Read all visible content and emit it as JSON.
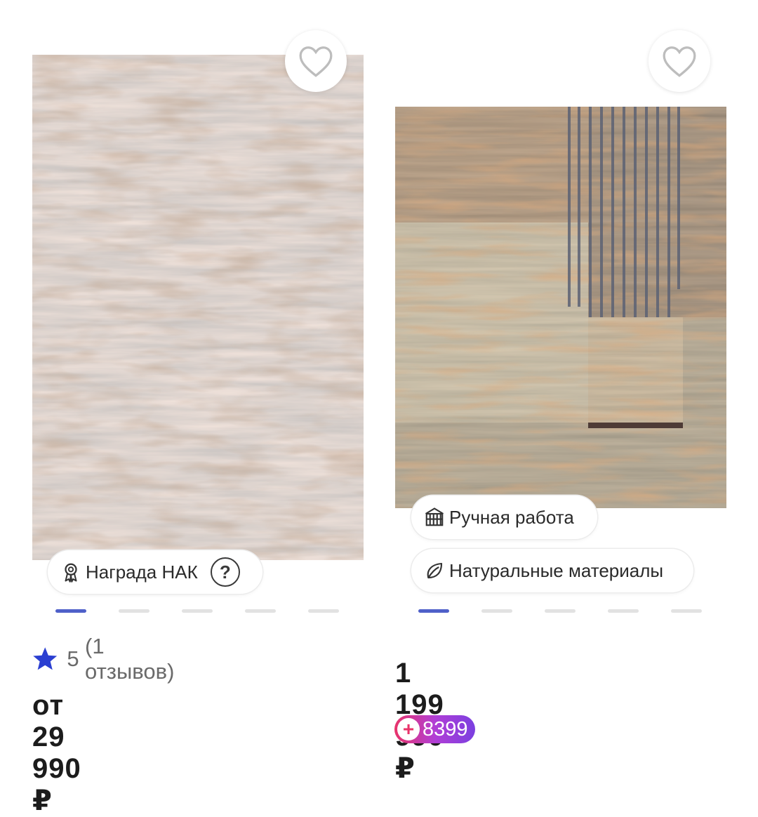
{
  "products": [
    {
      "favorite_icon": "heart-outline-icon",
      "badges": [
        {
          "icon": "award-ribbon-icon",
          "label": "Награда НАК",
          "help": "?"
        }
      ],
      "carousel": {
        "total": 5,
        "active": 1
      },
      "rating": {
        "icon": "star-icon",
        "value": "5",
        "reviews": "(1 отзывов)"
      },
      "price": "от 29 990 ₽"
    },
    {
      "favorite_icon": "heart-outline-icon",
      "badges": [
        {
          "icon": "handmade-loom-icon",
          "label": "Ручная работа"
        },
        {
          "icon": "leaf-icon",
          "label": "Натуральные материалы"
        }
      ],
      "carousel": {
        "total": 5,
        "active": 1
      },
      "price": "1 199 990 ₽",
      "bonus": {
        "icon": "plus-icon",
        "value": "8399"
      }
    }
  ],
  "colors": {
    "accent": "#4f60c9",
    "star": "#2b3fd1",
    "bonus_start": "#e8336a",
    "bonus_end": "#7b3fe0"
  }
}
